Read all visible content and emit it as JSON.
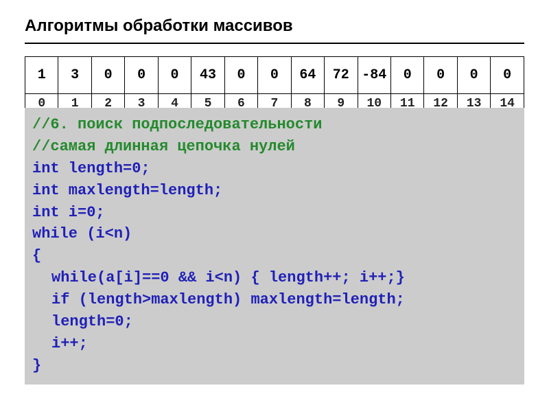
{
  "title": "Алгоритмы обработки массивов",
  "array": {
    "values": [
      "1",
      "3",
      "0",
      "0",
      "0",
      "43",
      "0",
      "0",
      "64",
      "72",
      "-84",
      "0",
      "0",
      "0",
      "0"
    ],
    "indices": [
      "0",
      "1",
      "2",
      "3",
      "4",
      "5",
      "6",
      "7",
      "8",
      "9",
      "10",
      "11",
      "12",
      "13",
      "14"
    ]
  },
  "code": {
    "c1": "//6. поиск подпоследовательности",
    "c2": "//самая длинная цепочка нулей",
    "l1": "int length=0;",
    "l2": "int maxlength=length;",
    "l3": "int i=0;",
    "l4": "while (i<n)",
    "l5": "{",
    "l6": "while(a[i]==0 && i<n) { length++; i++;}",
    "l7": "if (length>maxlength) maxlength=length;",
    "l8": "length=0;",
    "l9": "i++;",
    "l10": "}"
  }
}
